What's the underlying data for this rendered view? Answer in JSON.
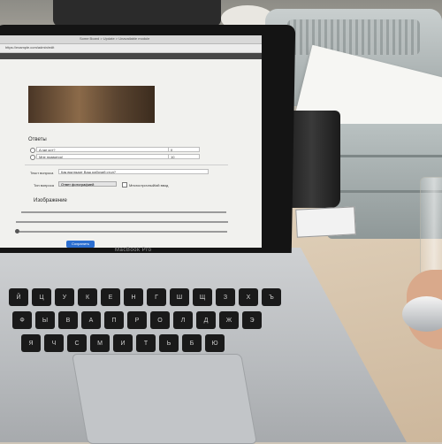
{
  "laptop": {
    "brand": "MacBook Pro"
  },
  "browser": {
    "title": "Some Board > Update > Unavailable module",
    "url": "https://example.com/admin/edit"
  },
  "form": {
    "answers_heading": "Ответы",
    "answers": [
      {
        "text": "A где кот?",
        "value": "0"
      },
      {
        "text": "Мне нравится!",
        "value": "10"
      }
    ],
    "question_text_label": "Текст вопроса",
    "question_text_value": "Как выглядит Ваш рабочий стол?",
    "question_type_label": "Тип вопроса",
    "question_type_value": "Ответ фотографией",
    "multiline_checkbox_label": "Многострочный/ий ввод",
    "image_heading": "Изображение",
    "submit_label": "Сохранить"
  },
  "keyboard": {
    "row1": [
      "Й",
      "Ц",
      "У",
      "К",
      "Е",
      "Н",
      "Г",
      "Ш",
      "Щ",
      "З",
      "Х",
      "Ъ"
    ],
    "row2": [
      "Ф",
      "Ы",
      "В",
      "А",
      "П",
      "Р",
      "О",
      "Л",
      "Д",
      "Ж",
      "Э"
    ],
    "row3": [
      "Я",
      "Ч",
      "С",
      "М",
      "И",
      "Т",
      "Ь",
      "Б",
      "Ю"
    ]
  }
}
